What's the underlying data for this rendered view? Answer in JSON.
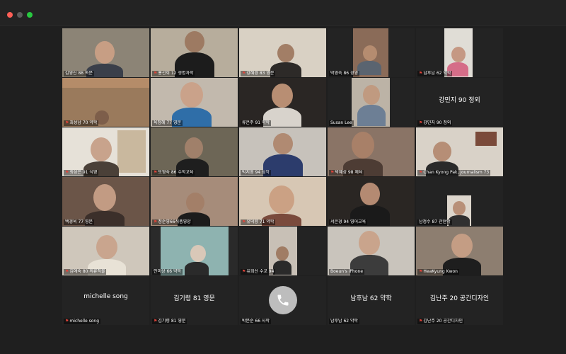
{
  "window": {
    "controls": [
      "close",
      "minimize",
      "zoom"
    ]
  },
  "tiles": [
    {
      "name": "김영신 88 독문",
      "mic_muted": false
    },
    {
      "name": "홍선희 12 생명과학",
      "mic_muted": true
    },
    {
      "name": "강혜경 83 영문",
      "mic_muted": true
    },
    {
      "name": "박영숙 86 경영",
      "mic_muted": false
    },
    {
      "name": "남후남 62 약학",
      "mic_muted": true
    },
    {
      "name": "최성남 70 약학",
      "mic_muted": true
    },
    {
      "name": "육정혜 77 영문",
      "mic_muted": false
    },
    {
      "name": "류은주 91 약학",
      "mic_muted": false
    },
    {
      "name": "Susan Lee",
      "mic_muted": false
    },
    {
      "name": "강민지 90 정외",
      "mic_muted": true,
      "center_label": "강민지 90 정외"
    },
    {
      "name": "최성은 91 식영",
      "mic_muted": true
    },
    {
      "name": "모영숙 86 수학교육",
      "mic_muted": true
    },
    {
      "name": "박지영 94 성악",
      "mic_muted": false
    },
    {
      "name": "박혜성 98 체육",
      "mic_muted": true
    },
    {
      "name": "Chan Kyong Pak, Journalism 73",
      "mic_muted": true
    },
    {
      "name": "백경옥 77 영문",
      "mic_muted": false
    },
    {
      "name": "정순영66식품영양",
      "mic_muted": true
    },
    {
      "name": "유덕향 71 약학",
      "mic_muted": true
    },
    {
      "name": "서은경 94 영어교육",
      "mic_muted": false
    },
    {
      "name": "남정수 87 관현악",
      "mic_muted": false
    },
    {
      "name": "김애숙 80 의류직물",
      "mic_muted": true
    },
    {
      "name": "안미상 66 약학",
      "mic_muted": false
    },
    {
      "name": "유희선 수교 94",
      "mic_muted": true
    },
    {
      "name": "Boeun's iPhone",
      "mic_muted": false,
      "active_speaker": true
    },
    {
      "name": "HeaKyung Kwon",
      "mic_muted": true
    },
    {
      "name": "michelle song",
      "mic_muted": true,
      "center_label": "michelle song"
    },
    {
      "name": "김기령 81 영문",
      "mic_muted": true,
      "center_label": "김기령 81 영문"
    },
    {
      "name": "박문순 66 사학",
      "mic_muted": false,
      "phone_call": true
    },
    {
      "name": "남후남 62 약학",
      "mic_muted": false,
      "center_label": "남후남 62 약학"
    },
    {
      "name": "김난주 20 공간디자인",
      "mic_muted": true,
      "center_label": "김난주 20 공간디자인"
    }
  ],
  "colors": {
    "active_speaker_border": "#3fcf55",
    "muted_mic": "#e0443a"
  }
}
